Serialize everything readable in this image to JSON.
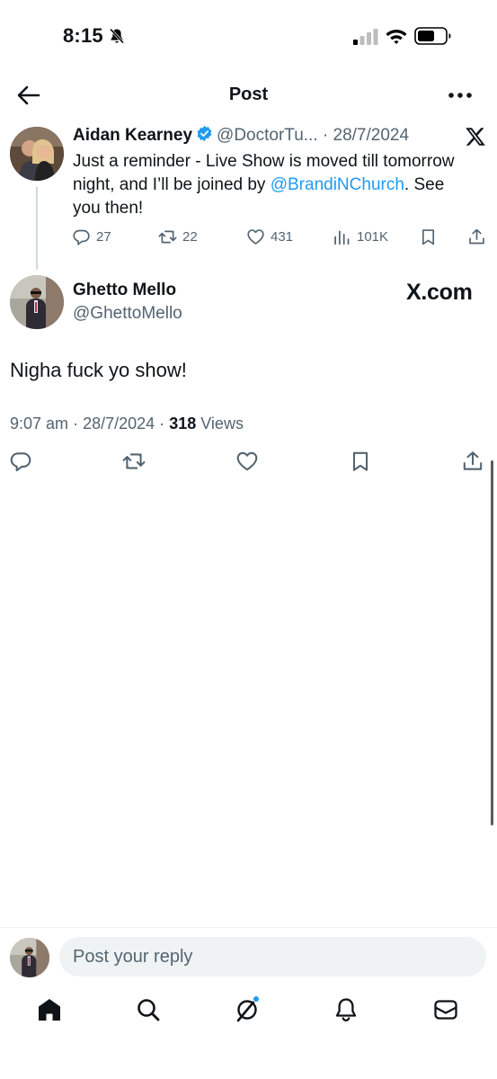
{
  "status_bar": {
    "time": "8:15"
  },
  "header": {
    "title": "Post"
  },
  "quoted_post": {
    "author_name": "Aidan Kearney",
    "handle": "@DoctorTu...",
    "date": "28/7/2024",
    "separator": "·",
    "text_lines": [
      "Just a reminder - Live Show is moved till tomorrow",
      "night, and I’ll be joined by ",
      "@BrandiNChurch",
      ". See",
      "you then!"
    ],
    "replies": "27",
    "reposts": "22",
    "likes": "431",
    "views": "101K"
  },
  "main_post": {
    "author_name": "Ghetto Mello",
    "handle": "@GhettoMello",
    "watermark": "X.com",
    "text": "Nigha fuck yo show!",
    "time": "9:07 am",
    "date": "28/7/2024",
    "separator": "·",
    "views_count": "318",
    "views_label": "Views"
  },
  "reply": {
    "placeholder": "Post your reply"
  },
  "colors": {
    "accent": "#1d9bf0",
    "text": "#0f1419",
    "secondary": "#536471"
  },
  "icons": {
    "back": "arrow-left-icon",
    "more": "more-horizontal-icon",
    "verified": "verified-badge-icon",
    "x_logo": "x-logo-icon",
    "reply": "reply-icon",
    "repost": "repost-icon",
    "like": "heart-icon",
    "views": "views-chart-icon",
    "bookmark": "bookmark-icon",
    "share": "share-icon",
    "home": "home-icon",
    "search": "search-icon",
    "grok": "grok-icon",
    "notifications": "bell-icon",
    "messages": "mail-icon"
  }
}
